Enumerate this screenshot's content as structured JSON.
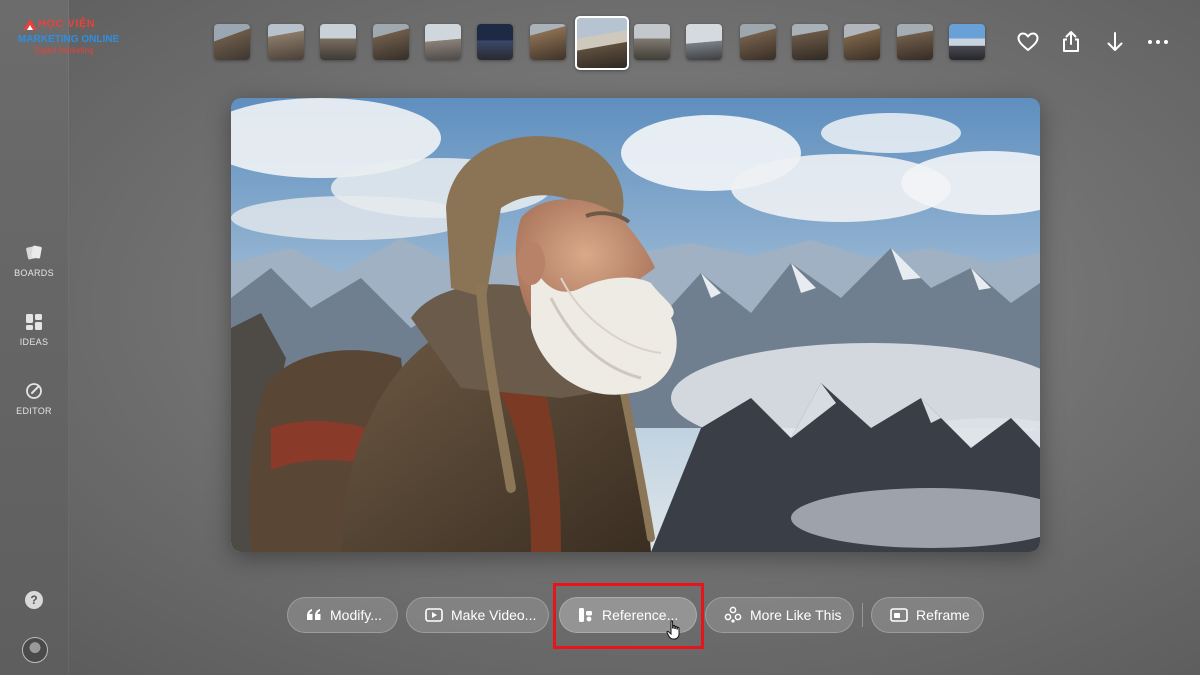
{
  "logo": {
    "line1": "HỌC VIỆN",
    "line2": "MARKETING ONLINE",
    "line3": "Digital Marketing"
  },
  "sidebar": {
    "items": [
      {
        "label": "BOARDS",
        "icon": "boards-icon"
      },
      {
        "label": "IDEAS",
        "icon": "ideas-icon"
      },
      {
        "label": "EDITOR",
        "icon": "editor-icon"
      }
    ],
    "help_label": "?",
    "avatar_icon": "user-avatar"
  },
  "thumbnails": {
    "count": 15,
    "selected_index": 7
  },
  "top_actions": [
    {
      "name": "favorite",
      "icon": "heart-icon"
    },
    {
      "name": "share",
      "icon": "share-icon"
    },
    {
      "name": "download",
      "icon": "download-icon"
    },
    {
      "name": "more",
      "icon": "more-icon"
    }
  ],
  "actions": [
    {
      "label": "Modify...",
      "icon": "quote-icon"
    },
    {
      "label": "Make Video...",
      "icon": "video-icon"
    },
    {
      "label": "Reference...",
      "icon": "reference-icon"
    },
    {
      "label": "More Like This",
      "icon": "more-like-this-icon"
    },
    {
      "label": "Reframe",
      "icon": "reframe-icon"
    }
  ],
  "colors": {
    "highlight": "#e8141b",
    "brand_red": "#e8423a",
    "brand_blue": "#2e8fe0"
  }
}
